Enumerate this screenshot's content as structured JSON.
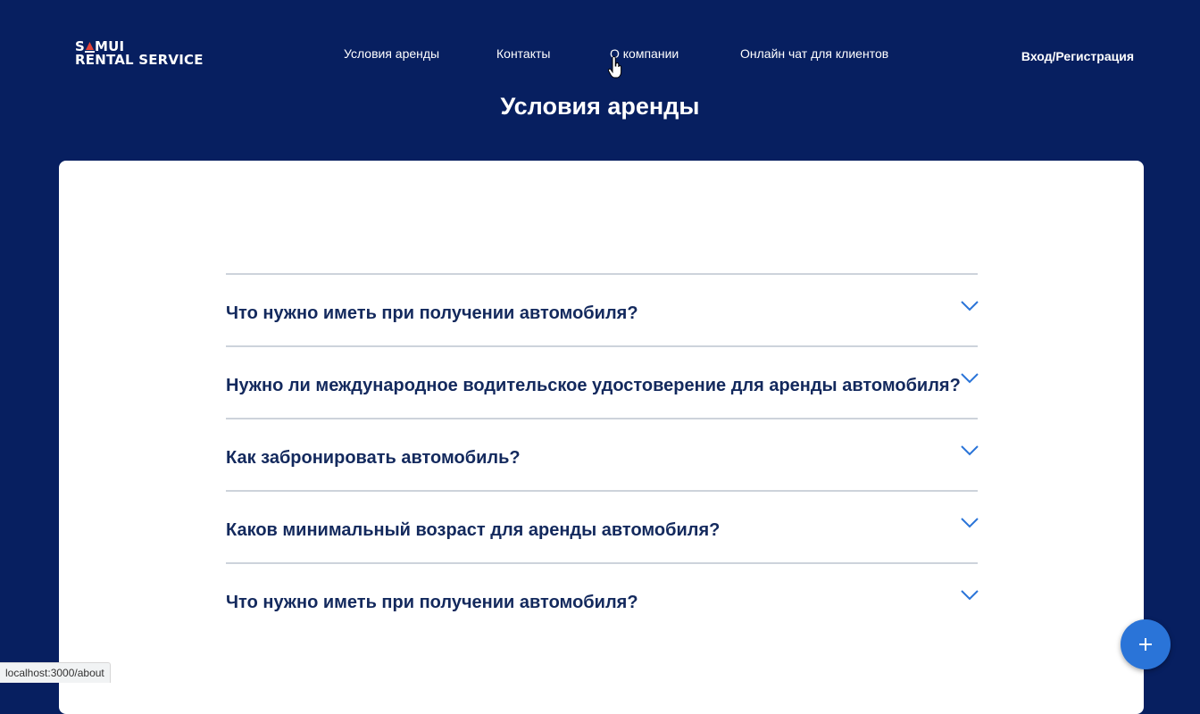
{
  "logo": {
    "line1": "SAMUI",
    "line2": "RENTAL SERVICE"
  },
  "nav": {
    "items": [
      {
        "label": "Условия аренды"
      },
      {
        "label": "Контакты"
      },
      {
        "label": "О компании"
      },
      {
        "label": "Онлайн чат для клиентов"
      }
    ],
    "login": "Вход/Регистрация"
  },
  "page": {
    "title": "Условия аренды"
  },
  "faq": {
    "items": [
      {
        "question": "Что нужно иметь при получении автомобиля?"
      },
      {
        "question": "Нужно ли международное водительское удостоверение для аренды автомобиля?"
      },
      {
        "question": "Как забронировать автомобиль?"
      },
      {
        "question": "Каков минимальный возраст для аренды автомобиля?"
      },
      {
        "question": "Что нужно иметь при получении автомобиля?"
      }
    ]
  },
  "fab": {
    "icon": "plus-icon"
  },
  "status_bar": {
    "url": "localhost:3000/about"
  },
  "colors": {
    "header_bg": "#071f60",
    "accent": "#2a74d8",
    "question_text": "#13295d"
  }
}
